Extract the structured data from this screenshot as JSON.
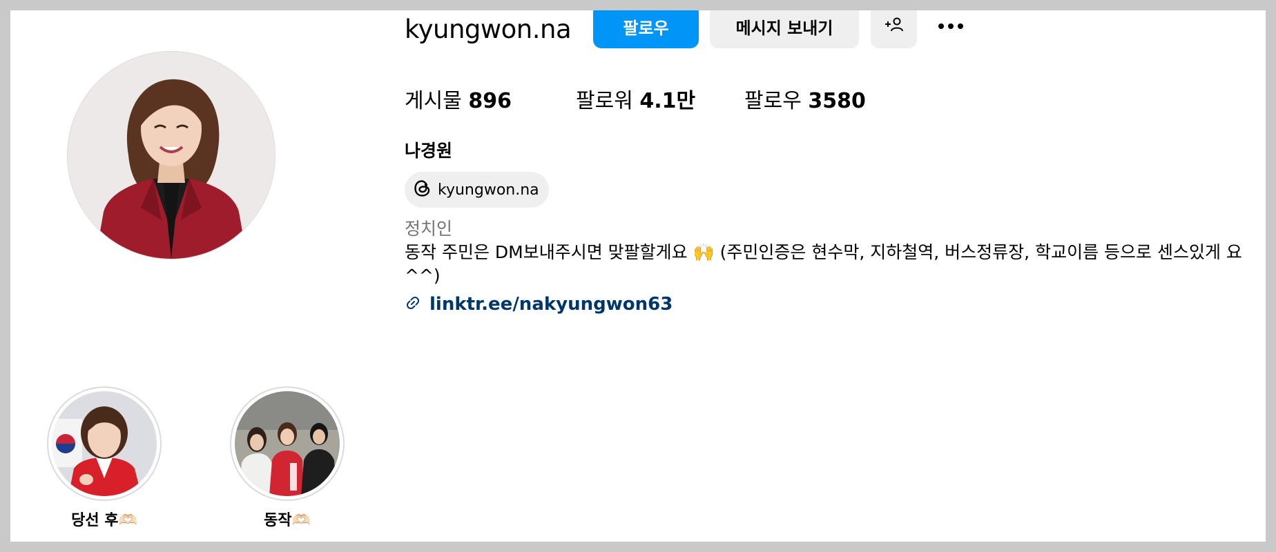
{
  "profile": {
    "username": "kyungwon.na",
    "full_name": "나경원",
    "threads_handle": "kyungwon.na",
    "category": "정치인",
    "bio": "동작 주민은 DM보내주시면 맞팔할게요 🙌 (주민인증은 현수막, 지하철역, 버스정류장, 학교이름 등으로 센스있게 요^^)",
    "link": "linktr.ee/nakyungwon63"
  },
  "actions": {
    "follow_label": "팔로우",
    "message_label": "메시지 보내기"
  },
  "stats": {
    "posts_label": "게시물",
    "posts_value": "896",
    "followers_label": "팔로워",
    "followers_value": "4.1만",
    "following_label": "팔로우",
    "following_value": "3580"
  },
  "highlights": [
    {
      "label": "당선 후🫶🏻"
    },
    {
      "label": "동작🫶🏻"
    }
  ],
  "colors": {
    "accent": "#0095f6",
    "link": "#00376b",
    "button_bg": "#efefef",
    "secondary_text": "#737373"
  },
  "icons": {
    "suggest": "person-plus-icon",
    "more": "more-options-icon",
    "threads": "threads-icon",
    "link": "link-icon"
  }
}
